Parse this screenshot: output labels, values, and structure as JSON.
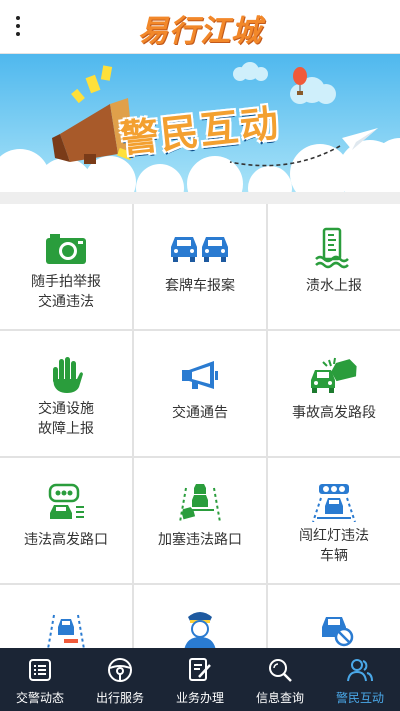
{
  "header": {
    "title": "易行江城",
    "menu_icon": "more-vertical-icon"
  },
  "banner": {
    "text": "警民互动",
    "colors": {
      "sky": "#6cc8f0",
      "banner_text": "#f3a030",
      "accent": "#ffe03a"
    }
  },
  "grid": {
    "items": [
      {
        "label": "随手拍举报\n交通违法",
        "icon": "camera-icon"
      },
      {
        "label": "套牌车报案",
        "icon": "cars-icon"
      },
      {
        "label": "渍水上报",
        "icon": "water-level-icon"
      },
      {
        "label": "交通设施\n故障上报",
        "icon": "hand-icon"
      },
      {
        "label": "交通通告",
        "icon": "megaphone-icon"
      },
      {
        "label": "事故高发路段",
        "icon": "car-crash-icon"
      },
      {
        "label": "违法高发路口",
        "icon": "chat-car-icon"
      },
      {
        "label": "加塞违法路口",
        "icon": "lane-cut-icon"
      },
      {
        "label": "闯红灯违法\n车辆",
        "icon": "traffic-light-car-icon"
      },
      {
        "label": "",
        "icon": "car-road-icon"
      },
      {
        "label": "",
        "icon": "police-officer-icon"
      },
      {
        "label": "",
        "icon": "no-parking-car-icon"
      }
    ]
  },
  "tabs": [
    {
      "label": "交警动态",
      "icon": "news-list-icon",
      "active": false
    },
    {
      "label": "出行服务",
      "icon": "steering-wheel-icon",
      "active": false
    },
    {
      "label": "业务办理",
      "icon": "edit-document-icon",
      "active": false
    },
    {
      "label": "信息查询",
      "icon": "search-icon",
      "active": false
    },
    {
      "label": "警民互动",
      "icon": "people-icon",
      "active": true
    }
  ],
  "colors": {
    "tabbar_bg": "#1b2535",
    "tab_active": "#4aa8e8",
    "icon_green": "#2a9d3c",
    "icon_blue": "#2a7bd1"
  }
}
